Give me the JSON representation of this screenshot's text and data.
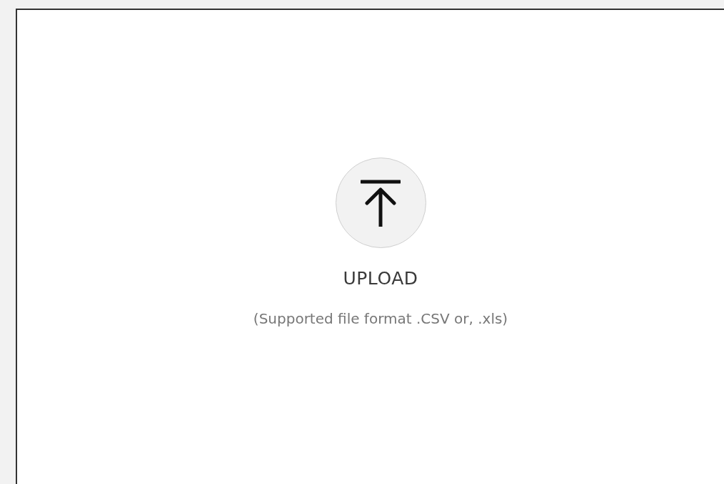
{
  "upload": {
    "label": "UPLOAD",
    "hint": "(Supported file format .CSV or, .xls)"
  }
}
